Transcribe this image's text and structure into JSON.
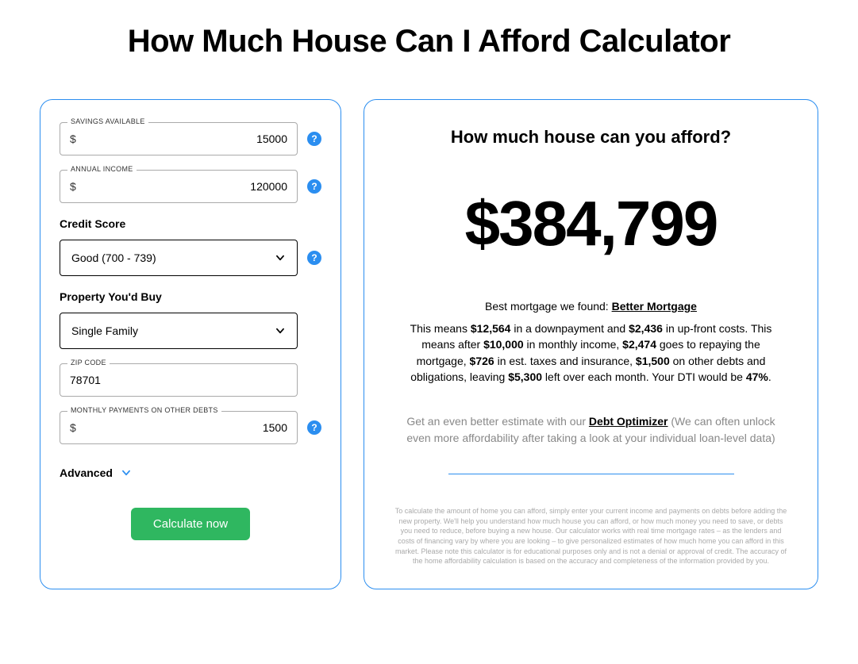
{
  "title": "How Much House Can I Afford Calculator",
  "form": {
    "savings": {
      "label": "SAVINGS AVAILABLE",
      "prefix": "$",
      "value": "15000"
    },
    "income": {
      "label": "ANNUAL INCOME",
      "prefix": "$",
      "value": "120000"
    },
    "credit": {
      "label": "Credit Score",
      "value": "Good (700 - 739)"
    },
    "property": {
      "label": "Property You'd Buy",
      "value": "Single Family"
    },
    "zip": {
      "label": "ZIP CODE",
      "value": "78701"
    },
    "debts": {
      "label": "MONTHLY PAYMENTS ON OTHER DEBTS",
      "prefix": "$",
      "value": "1500"
    },
    "advanced_label": "Advanced",
    "calculate_label": "Calculate now"
  },
  "result": {
    "heading": "How much house can you afford?",
    "amount": "$384,799",
    "best_prefix": "Best mortgage we found: ",
    "best_link": "Better Mortgage",
    "explain": {
      "t1": "This means ",
      "downpayment": "$12,564",
      "t2": " in a downpayment and ",
      "upfront": "$2,436",
      "t3": " in up-front costs. This means after ",
      "monthly_income": "$10,000",
      "t4": " in monthly income, ",
      "repay": "$2,474",
      "t5": " goes to repaying the mortgage, ",
      "taxes": "$726",
      "t6": " in est. taxes and insurance, ",
      "other_debts": "$1,500",
      "t7": " on other debts and obligations, leaving ",
      "leftover": "$5,300",
      "t8": " left over each month. Your DTI would be ",
      "dti": "47%",
      "t9": "."
    },
    "optimizer_prefix": "Get an even better estimate with our ",
    "optimizer_link": "Debt Optimizer",
    "optimizer_suffix": " (We can often unlock even more affordability after taking a look at your individual loan-level data)",
    "disclaimer": "To calculate the amount of home you can afford, simply enter your current income and payments on debts before adding the new property. We'll help you understand how much house you can afford, or how much money you need to save, or debts you need to reduce, before buying a new house. Our calculator works with real time mortgage rates – as the lenders and costs of financing vary by where you are looking – to give personalized estimates of how much home you can afford in this market. Please note this calculator is for educational purposes only and is not a denial or approval of credit. The accuracy of the home affordability calculation is based on the accuracy and completeness of the information provided by you."
  }
}
